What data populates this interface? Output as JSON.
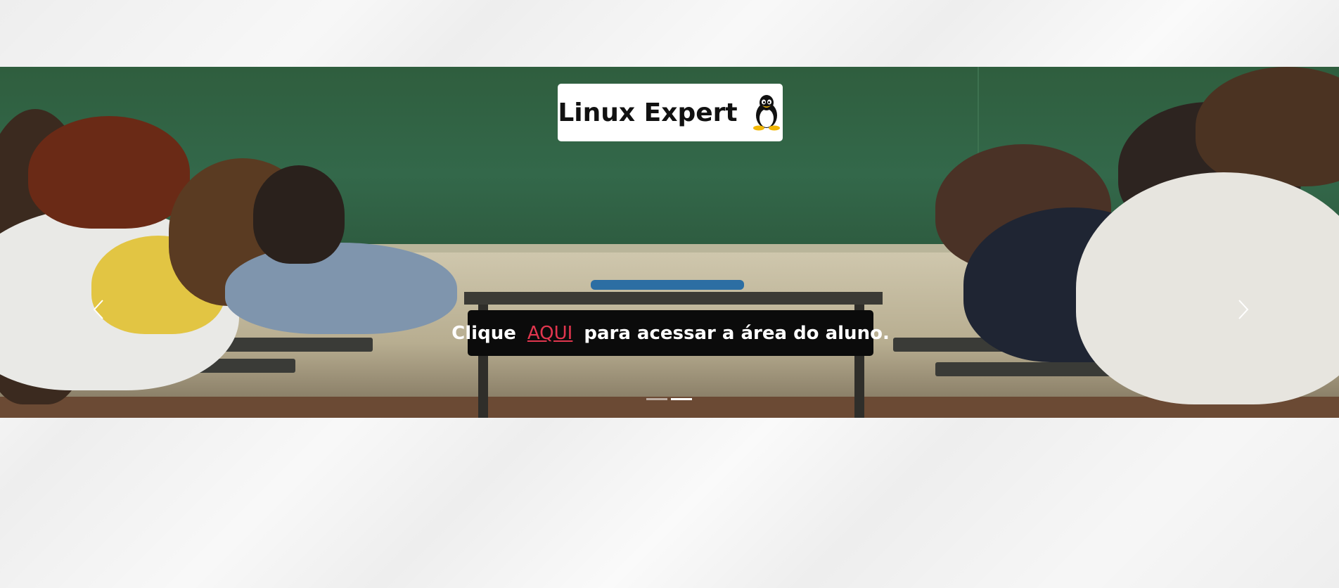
{
  "brand": {
    "title": "Linux Expert",
    "logo_icon": "tux-penguin-icon"
  },
  "cta": {
    "prefix": "Clique",
    "link_label": "AQUI",
    "suffix": "para acessar a área do aluno.",
    "link_color": "#e0364e"
  },
  "carousel": {
    "prev_icon": "chevron-left-icon",
    "next_icon": "chevron-right-icon",
    "slides_total": 2,
    "active_slide": 2
  },
  "colors": {
    "chalkboard": "#33684a",
    "cta_background": "#0b0b0b"
  }
}
